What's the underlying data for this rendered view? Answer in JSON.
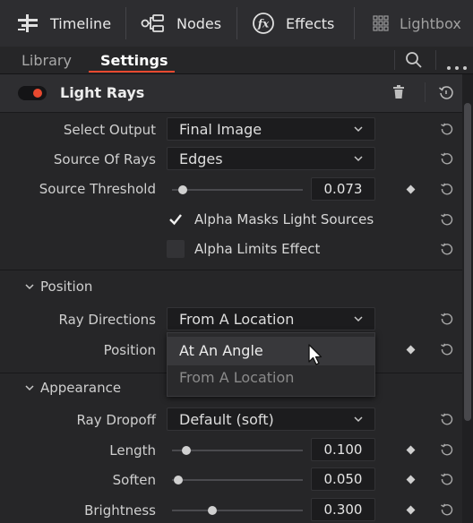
{
  "topbar": {
    "timeline": "Timeline",
    "nodes": "Nodes",
    "effects": "Effects",
    "lightbox": "Lightbox"
  },
  "tabs": {
    "library": "Library",
    "settings": "Settings"
  },
  "effect": {
    "name": "Light Rays",
    "enabled": true,
    "accent": "#e8492f"
  },
  "controls": {
    "select_output": {
      "label": "Select Output",
      "value": "Final Image"
    },
    "source_of_rays": {
      "label": "Source Of Rays",
      "value": "Edges"
    },
    "source_threshold": {
      "label": "Source Threshold",
      "value": "0.073"
    },
    "alpha_masks": {
      "label": "Alpha Masks Light Sources",
      "checked": true
    },
    "alpha_limits": {
      "label": "Alpha Limits Effect",
      "checked": false
    }
  },
  "position_section": {
    "title": "Position",
    "ray_directions": {
      "label": "Ray Directions",
      "value": "From A Location"
    },
    "position": {
      "label": "Position"
    },
    "menu_options": [
      "At An Angle",
      "From A Location"
    ]
  },
  "appearance_section": {
    "title": "Appearance",
    "ray_dropoff": {
      "label": "Ray Dropoff",
      "value": "Default (soft)"
    },
    "length": {
      "label": "Length",
      "value": "0.100"
    },
    "soften": {
      "label": "Soften",
      "value": "0.050"
    },
    "brightness": {
      "label": "Brightness",
      "value": "0.300"
    }
  }
}
